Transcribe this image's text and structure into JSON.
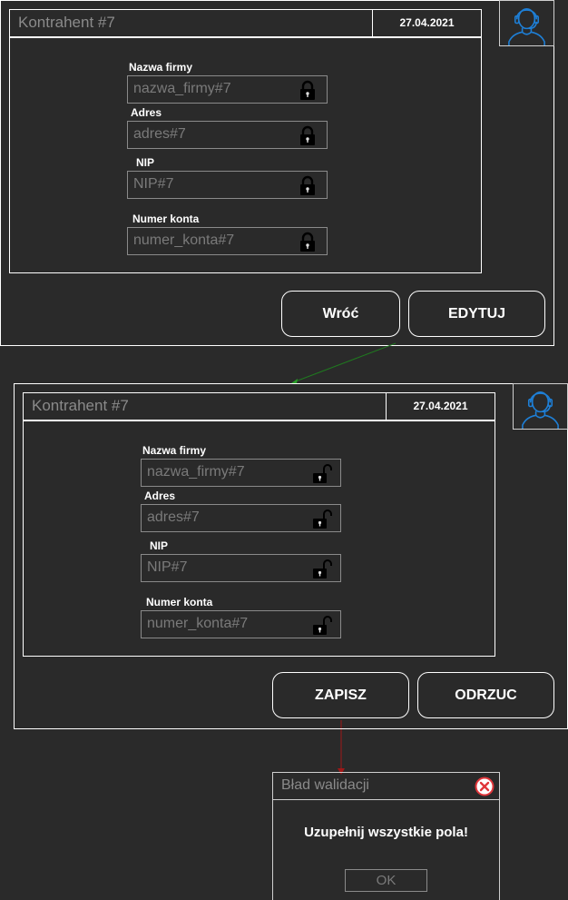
{
  "screen1": {
    "title": "Kontrahent #7",
    "date": "27.04.2021",
    "fields": [
      {
        "label": "Nazwa firmy",
        "value": "nazwa_firmy#7",
        "lock": "locked"
      },
      {
        "label": "Adres",
        "value": "adres#7",
        "lock": "locked"
      },
      {
        "label": "NIP",
        "value": "NIP#7",
        "lock": "locked"
      },
      {
        "label": "Numer konta",
        "value": "numer_konta#7",
        "lock": "locked"
      }
    ],
    "buttons": {
      "back": "Wróć",
      "edit": "EDYTUJ"
    }
  },
  "screen2": {
    "title": "Kontrahent #7",
    "date": "27.04.2021",
    "fields": [
      {
        "label": "Nazwa firmy",
        "value": "nazwa_firmy#7",
        "lock": "unlocked"
      },
      {
        "label": "Adres",
        "value": "adres#7",
        "lock": "unlocked"
      },
      {
        "label": "NIP",
        "value": "NIP#7",
        "lock": "unlocked"
      },
      {
        "label": "Numer konta",
        "value": "numer_konta#7",
        "lock": "unlocked"
      }
    ],
    "buttons": {
      "save": "ZAPISZ",
      "reject": "ODRZUC"
    }
  },
  "dialog": {
    "title": "Bład walidacji",
    "message": "Uzupełnij wszystkie pola!",
    "ok": "OK"
  },
  "connectors": {
    "edit_to_screen2": "#1f7a1f",
    "save_to_dialog": "#a01818"
  },
  "icons": {
    "avatar": "user-avatar-icon",
    "locked": "padlock-locked-icon",
    "unlocked": "padlock-unlocked-icon",
    "close": "close-circle-icon"
  },
  "colors": {
    "background": "#2a2a2a",
    "avatar_blue": "#1e7fd6",
    "close_red": "#e0353a"
  }
}
